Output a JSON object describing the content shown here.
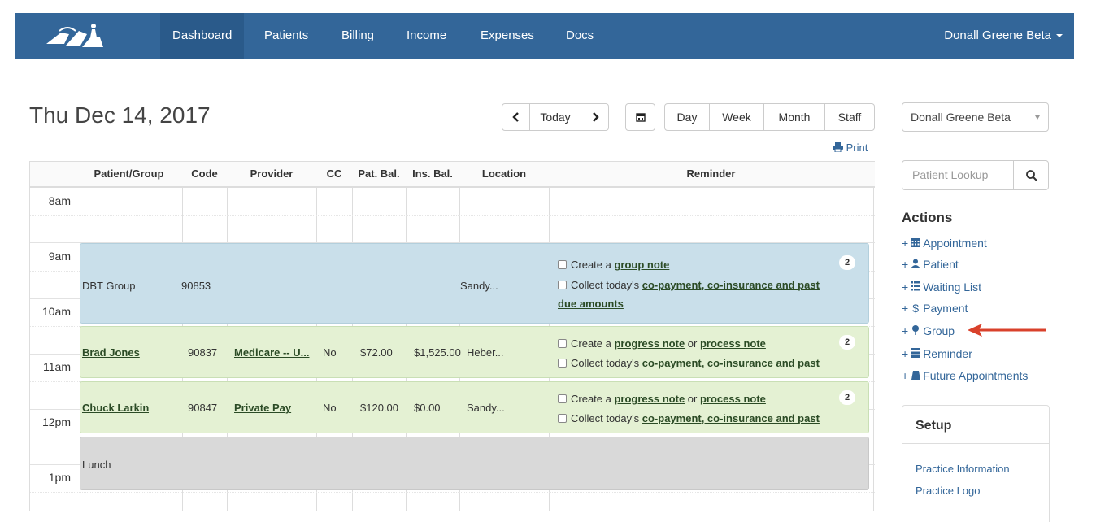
{
  "nav": {
    "items": [
      "Dashboard",
      "Patients",
      "Billing",
      "Income",
      "Expenses",
      "Docs"
    ],
    "user": "Donall Greene Beta"
  },
  "header": {
    "date": "Thu Dec 14, 2017",
    "today": "Today",
    "views": [
      "Day",
      "Week",
      "Month",
      "Staff"
    ],
    "print": "Print"
  },
  "table": {
    "columns": [
      "Patient/Group",
      "Code",
      "Provider",
      "CC",
      "Pat. Bal.",
      "Ins. Bal.",
      "Location",
      "Reminder"
    ],
    "times": [
      "8am",
      "9am",
      "10am",
      "11am",
      "12pm",
      "1pm"
    ]
  },
  "events": {
    "group": {
      "name": "DBT Group",
      "code": "90853",
      "location": "Sandy...",
      "rem1_pre": "Create a ",
      "rem1_link": "group note",
      "rem2_pre": "Collect today's ",
      "rem2_link": "co-payment, co-insurance and past",
      "rem2_link2": "due amounts",
      "badge": "2"
    },
    "brad": {
      "name": "Brad Jones",
      "code": "90837",
      "provider": "Medicare -- U...",
      "cc": "No",
      "pat_bal": "$72.00",
      "ins_bal": "$1,525.00",
      "location": "Heber...",
      "rem1_pre": "Create a ",
      "rem1_link": "progress note",
      "rem1_mid": " or ",
      "rem1_link2": "process note",
      "rem2_pre": "Collect today's ",
      "rem2_link": "co-payment, co-insurance and past",
      "badge": "2"
    },
    "chuck": {
      "name": "Chuck Larkin",
      "code": "90847",
      "provider": "Private Pay",
      "cc": "No",
      "pat_bal": "$120.00",
      "ins_bal": "$0.00",
      "location": "Sandy...",
      "rem1_pre": "Create a ",
      "rem1_link": "progress note",
      "rem1_mid": " or ",
      "rem1_link2": "process note",
      "rem2_pre": "Collect today's ",
      "rem2_link": "co-payment, co-insurance and past",
      "badge": "2"
    },
    "lunch": {
      "name": "Lunch"
    }
  },
  "sidebar": {
    "provider": "Donall Greene Beta",
    "lookup_placeholder": "Patient Lookup",
    "actions_title": "Actions",
    "actions": [
      "Appointment",
      "Patient",
      "Waiting List",
      "Payment",
      "Group",
      "Reminder",
      "Future Appointments"
    ],
    "setup_title": "Setup",
    "setup_links": [
      "Practice Information",
      "Practice Logo"
    ]
  },
  "colors": {
    "navbar": "#336699",
    "group_event": "#c9dfea",
    "appointment_event": "#e4f1d3",
    "lunch_event": "#d9d9d9",
    "arrow": "#d9412b"
  }
}
